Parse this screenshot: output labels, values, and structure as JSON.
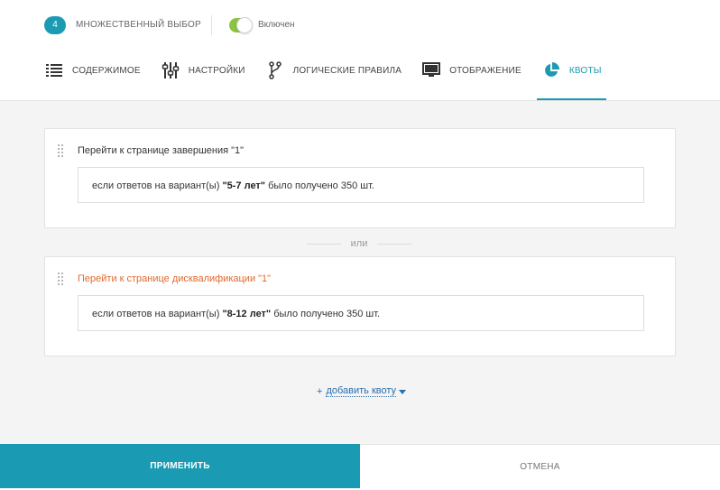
{
  "header": {
    "question_number": "4",
    "question_type": "МНОЖЕСТВЕННЫЙ ВЫБОР",
    "toggle_label": "Включен",
    "toggle_on": true
  },
  "tabs": [
    {
      "label": "СОДЕРЖИМОЕ",
      "icon": "list-icon",
      "active": false
    },
    {
      "label": "НАСТРОЙКИ",
      "icon": "sliders-icon",
      "active": false
    },
    {
      "label": "ЛОГИЧЕСКИЕ ПРАВИЛА",
      "icon": "branch-icon",
      "active": false
    },
    {
      "label": "ОТОБРАЖЕНИЕ",
      "icon": "monitor-icon",
      "active": false
    },
    {
      "label": "КВОТЫ",
      "icon": "pie-chart-icon",
      "active": true
    }
  ],
  "quotas": [
    {
      "title": "Перейти к странице завершения \"1\"",
      "title_color": "#333333",
      "condition_prefix": "если ответов на вариант(ы) ",
      "condition_value": "\"5-7 лет\"",
      "condition_suffix": " было получено 350 шт."
    },
    {
      "title": "Перейти к странице дисквалификации \"1\"",
      "title_color": "#e06a2e",
      "condition_prefix": "если ответов на вариант(ы) ",
      "condition_value": "\"8-12 лет\"",
      "condition_suffix": " было получено 350 шт."
    }
  ],
  "separator_label": "или",
  "add_quota": {
    "plus": "+",
    "label": "добавить квоту"
  },
  "footer": {
    "apply_label": "ПРИМЕНИТЬ",
    "cancel_label": "ОТМЕНА"
  },
  "colors": {
    "accent": "#1a9bb3",
    "toggle": "#8bc53f",
    "warning": "#e06a2e",
    "link": "#2a6ead"
  }
}
